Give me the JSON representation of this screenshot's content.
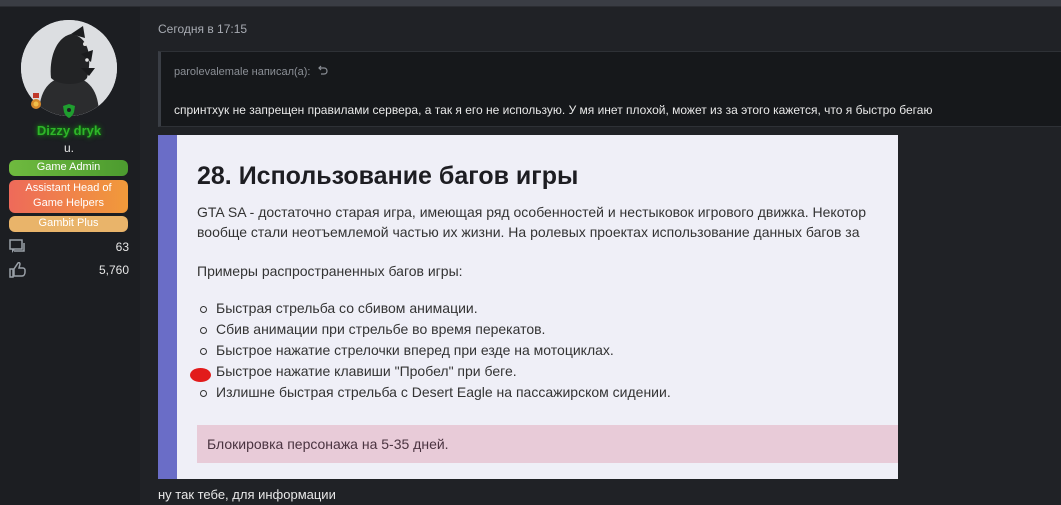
{
  "message": {
    "timestamp": "Сегодня в 17:15",
    "quote": {
      "author_line": "parolevalemale написал(а):",
      "text": "спринтхук не запрещен правилами сервера, а так я его не использую. У мя инет плохой, может из за этого кажется, что я быстро бегаю"
    },
    "rules_excerpt": {
      "title": "28. Использование багов игры",
      "para1_line1": "GTA SA - достаточно старая игра, имеющая ряд особенностей и нестыковок игрового движка. Некотор",
      "para1_line2": "вообще стали неотъемлемой частью их жизни. На ролевых проектах использование данных багов за",
      "examples_heading": "Примеры распространенных багов игры:",
      "bullets": [
        "Быстрая стрельба со сбивом анимации.",
        "Сбив анимации при стрельбе во время перекатов.",
        "Быстрое нажатие стрелочки вперед при езде на мотоциклах.",
        "Быстрое нажатие клавиши \"Пробел\" при беге.",
        "Излишне быстрая стрельба с Desert Eagle на пассажирском сидении."
      ],
      "penalty": "Блокировка персонажа на 5-35 дней."
    },
    "reply_text": "ну так тебе, для информации"
  },
  "user": {
    "name": "Dizzy dryk",
    "title": "u.",
    "banners": [
      "Game Admin",
      "Assistant Head of Game Helpers",
      "Gambit Plus"
    ],
    "stats": {
      "messages": "63",
      "reactions": "5,760"
    },
    "name_color": "#2fb52a"
  },
  "colors": {
    "accent_rules_bar": "#6a6dc7",
    "penalty_bg": "#e8cbd8",
    "annotation_mark": "#e21b1b"
  }
}
